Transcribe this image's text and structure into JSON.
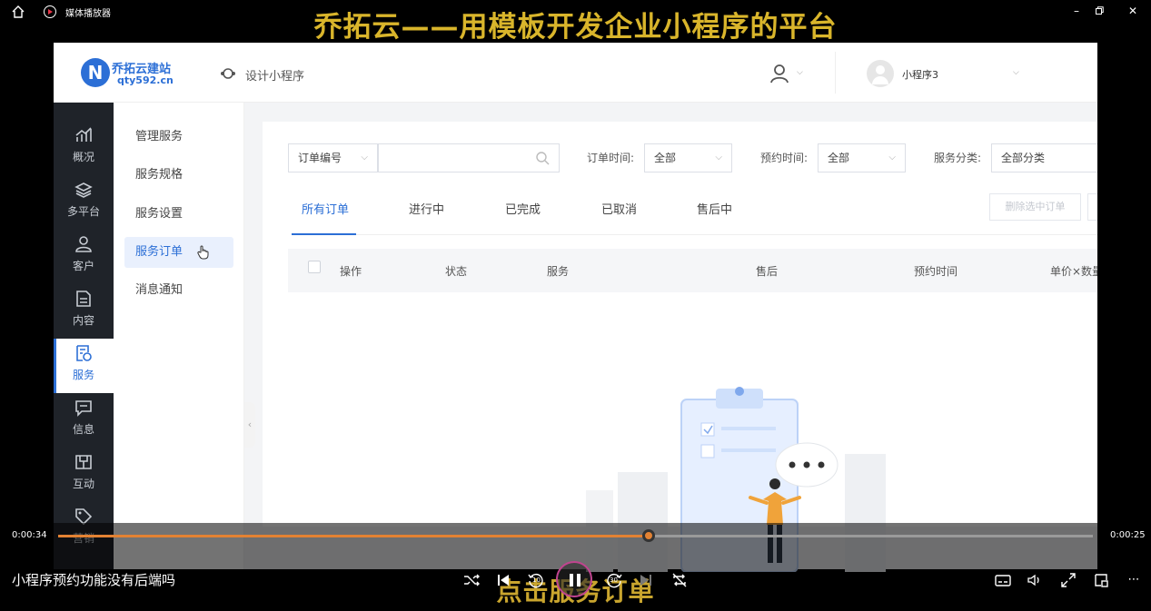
{
  "player": {
    "window_title": "媒体播放器",
    "overlay_top": "乔拓云——用模板开发企业小程序的平台",
    "overlay_bottom": "点击服务订单",
    "video_title": "小程序预约功能没有后端吗",
    "time_elapsed": "0:00:34",
    "time_remaining": "0:00:25",
    "progress": 0.571,
    "skip_back_label": "10",
    "skip_forward_label": "30",
    "accent_color": "#e38233"
  },
  "site": {
    "logo_mark": "N",
    "logo_name": "乔拓云建站",
    "logo_url": "qty592.cn",
    "design_label": "设计小程序",
    "account_name": "小程序3"
  },
  "dark_sidebar": {
    "items": [
      {
        "label": "概况",
        "icon": "chart-icon"
      },
      {
        "label": "多平台",
        "icon": "layers-icon"
      },
      {
        "label": "客户",
        "icon": "user-icon"
      },
      {
        "label": "内容",
        "icon": "document-icon"
      },
      {
        "label": "服务",
        "icon": "service-icon"
      },
      {
        "label": "信息",
        "icon": "message-icon"
      },
      {
        "label": "互动",
        "icon": "interact-icon"
      },
      {
        "label": "营销",
        "icon": "tag-icon"
      }
    ],
    "active_index": 4
  },
  "submenu": {
    "items": [
      "管理服务",
      "服务规格",
      "服务设置",
      "服务订单",
      "消息通知"
    ],
    "active_index": 3
  },
  "filters": {
    "order_no_select": "订单编号",
    "order_time_label": "订单时间:",
    "order_time_value": "全部",
    "book_time_label": "预约时间:",
    "book_time_value": "全部",
    "category_label": "服务分类:",
    "category_value": "全部分类"
  },
  "tabs": [
    "所有订单",
    "进行中",
    "已完成",
    "已取消",
    "售后中"
  ],
  "delete_selected": "删除选中订单",
  "table_headers": [
    "操作",
    "状态",
    "服务",
    "售后",
    "预约时间",
    "单价×数量"
  ],
  "colors": {
    "primary": "#2c6fd6",
    "sidebar_dark": "#1f2329"
  }
}
